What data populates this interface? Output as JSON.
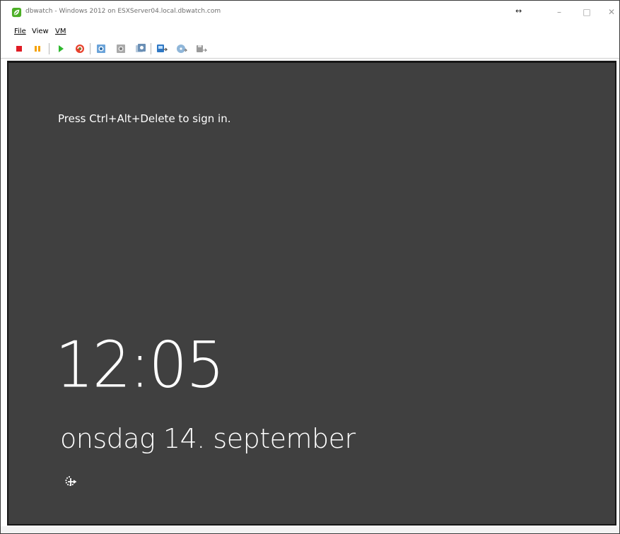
{
  "window": {
    "title": "dbwatch -  Windows 2012 on ESXServer04.local.dbwatch.com"
  },
  "menu": {
    "items": [
      {
        "id": "file",
        "label": "File"
      },
      {
        "id": "view",
        "label": "View"
      },
      {
        "id": "vm",
        "label": "VM"
      }
    ]
  },
  "toolbar": {
    "buttons": [
      {
        "id": "power-off",
        "icon": "stop-square-icon"
      },
      {
        "id": "suspend",
        "icon": "pause-icon"
      },
      {
        "id": "power-on",
        "icon": "play-icon"
      },
      {
        "id": "reset",
        "icon": "reset-icon"
      },
      {
        "id": "snapshot",
        "icon": "snapshot-icon"
      },
      {
        "id": "revert-snapshot",
        "icon": "revert-snapshot-icon"
      },
      {
        "id": "snapshot-manager",
        "icon": "snapshot-manager-icon"
      },
      {
        "id": "connect-devices",
        "icon": "connect-devices-icon"
      },
      {
        "id": "cd-dvd",
        "icon": "disc-icon"
      },
      {
        "id": "floppy",
        "icon": "floppy-icon"
      }
    ]
  },
  "console": {
    "signin_prompt": "Press Ctrl+Alt+Delete to sign in.",
    "time": "12:05",
    "date": "onsdag 14. september",
    "background_color": "#404040"
  },
  "colors": {
    "stop": "#e01b24",
    "pause": "#f5a100",
    "play": "#2eb82e",
    "app_icon": "#4caf26"
  }
}
